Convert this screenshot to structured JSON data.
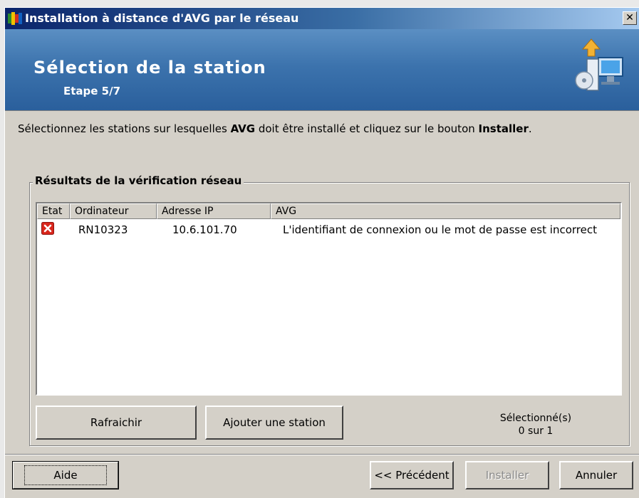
{
  "window": {
    "title": "Installation à distance d'AVG par le réseau",
    "close_label": "✕"
  },
  "header": {
    "title": "Sélection de la station",
    "step": "Etape 5/7"
  },
  "instruction": {
    "part1": "Sélectionnez les stations sur lesquelles ",
    "bold1": "AVG",
    "part2": " doit être installé et cliquez sur le bouton ",
    "bold2": "Installer",
    "part3": "."
  },
  "group": {
    "legend": "Résultats de la vérification réseau"
  },
  "table": {
    "columns": [
      "Etat",
      "Ordinateur",
      "Adresse IP",
      "AVG"
    ],
    "rows": [
      {
        "status_icon": "error-x-icon",
        "computer": "RN10323",
        "ip": "10.6.101.70",
        "avg": "L'identifiant de connexion ou le mot de passe est incorrect"
      }
    ]
  },
  "buttons": {
    "refresh": "Rafraichir",
    "add_station": "Ajouter une station",
    "help": "Aide",
    "previous": "<< Précédent",
    "install": "Installer",
    "cancel": "Annuler"
  },
  "selection": {
    "label": "Sélectionné(s)",
    "count": "0 sur 1"
  },
  "colors": {
    "error": "#d9261c",
    "header_blue": "#3c73ad"
  }
}
